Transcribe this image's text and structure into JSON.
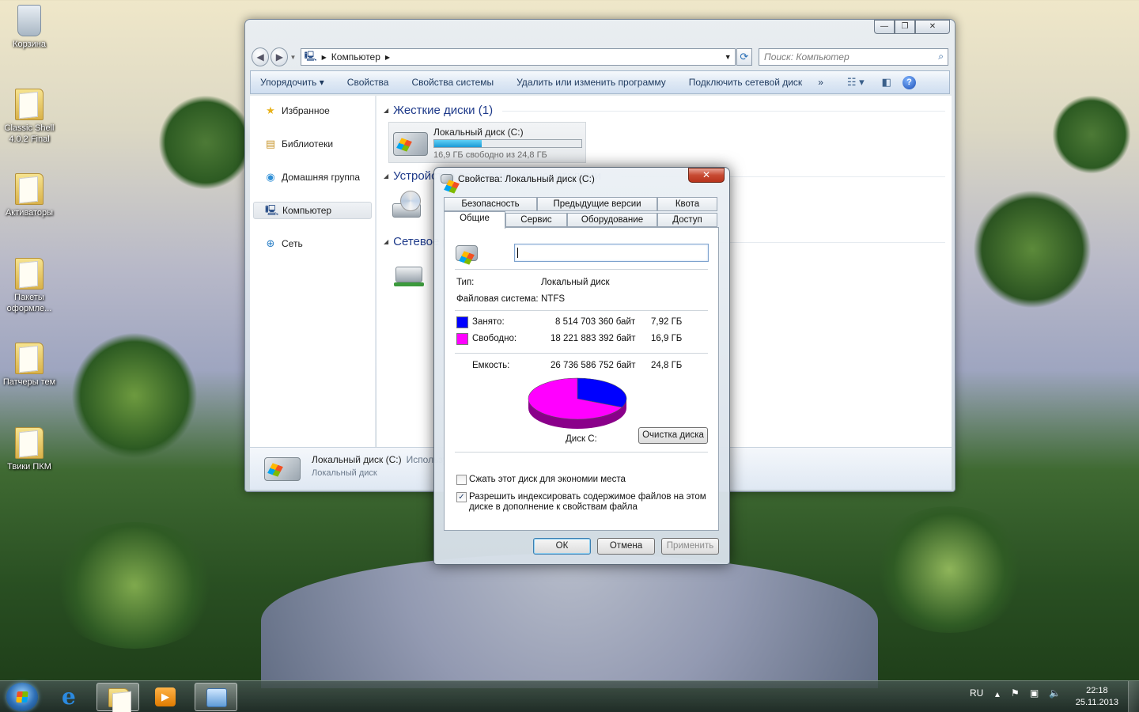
{
  "desktop": {
    "icons": [
      {
        "label": "Корзина",
        "type": "bin"
      },
      {
        "label": "Classic Shell 4.0.2 Final",
        "type": "folder"
      },
      {
        "label": "Активаторы",
        "type": "folder"
      },
      {
        "label": "Пакеты оформле...",
        "type": "folder"
      },
      {
        "label": "Патчеры тем",
        "type": "folder"
      },
      {
        "label": "Твики ПКМ",
        "type": "folder"
      }
    ]
  },
  "explorer": {
    "address": "Компьютер",
    "search_placeholder": "Поиск: Компьютер",
    "toolbar": {
      "organize": "Упорядочить",
      "properties": "Свойства",
      "system_properties": "Свойства системы",
      "uninstall": "Удалить или изменить программу",
      "map_drive": "Подключить сетевой диск",
      "more": "»"
    },
    "sidebar": [
      {
        "label": "Избранное",
        "icon": "star-icon"
      },
      {
        "label": "Библиотеки",
        "icon": "library-icon"
      },
      {
        "label": "Домашняя группа",
        "icon": "homegroup-icon"
      },
      {
        "label": "Компьютер",
        "icon": "computer-icon"
      },
      {
        "label": "Сеть",
        "icon": "network-icon"
      }
    ],
    "groups": {
      "hard_drives": "Жесткие диски (1)",
      "devices": "Устройства со съемными носителями",
      "network": "Сетевое расположение"
    },
    "drive": {
      "name": "Локальный диск (C:)",
      "free_text": "16,9 ГБ свободно из 24,8 ГБ",
      "used_fraction": 0.32
    },
    "details": {
      "name": "Локальный диск (C:)",
      "extra": "Используется:",
      "type": "Локальный диск"
    }
  },
  "dialog": {
    "title": "Свойства: Локальный диск (C:)",
    "close": "✕",
    "tabs_row1": [
      "Безопасность",
      "Предыдущие версии",
      "Квота"
    ],
    "tabs_row2": [
      "Общие",
      "Сервис",
      "Оборудование",
      "Доступ"
    ],
    "name_value": "",
    "type_label": "Тип:",
    "type_value": "Локальный диск",
    "fs_label": "Файловая система:",
    "fs_value": "NTFS",
    "used": {
      "label": "Занято:",
      "bytes": "8 514 703 360 байт",
      "size": "7,92 ГБ",
      "color": "#0000ff"
    },
    "free": {
      "label": "Свободно:",
      "bytes": "18 221 883 392 байт",
      "size": "16,9 ГБ",
      "color": "#ff00ff"
    },
    "capacity": {
      "label": "Емкость:",
      "bytes": "26 736 586 752 байт",
      "size": "24,8 ГБ"
    },
    "disk_label": "Диск C:",
    "cleanup": "Очистка диска",
    "compress": {
      "label": "Сжать этот диск для экономии места",
      "checked": false
    },
    "index": {
      "label1": "Разрешить индексировать содержимое файлов на этом",
      "label2": "диске в дополнение к свойствам файла",
      "checked": true,
      "mark": "✓"
    },
    "ok": "ОК",
    "cancel": "Отмена",
    "apply": "Применить"
  },
  "chart_data": {
    "type": "pie",
    "categories": [
      "Занято:",
      "Свободно:"
    ],
    "values": [
      8514703360,
      18221883392
    ],
    "colors": [
      "#0000ff",
      "#ff00ff"
    ],
    "title": "Диск C:"
  },
  "taskbar": {
    "lang": "RU",
    "time": "22:18",
    "date": "25.11.2013"
  }
}
